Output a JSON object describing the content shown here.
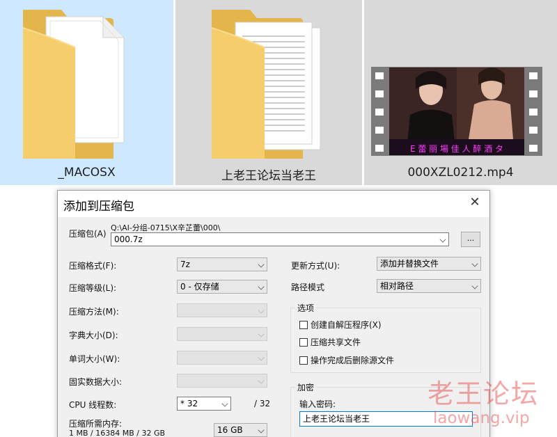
{
  "explorer": {
    "items": [
      {
        "name": "_MACOSX",
        "kind": "folder",
        "selected": true
      },
      {
        "name": "上老王论坛当老王",
        "kind": "folder",
        "selected": false
      },
      {
        "name": "000XZL0212.mp4",
        "kind": "video",
        "selected": false
      }
    ],
    "video_subtitle": "E 蕾 丽 場 佳 人 醉 酒 タ"
  },
  "dialog": {
    "title": "添加到压缩包",
    "close_glyph": "✕",
    "archive": {
      "label": "压缩包(A)",
      "path": "Q:\\AI-分组-0715\\X辛芷蕾\\000\\",
      "value": "000.7z",
      "browse_label": "..."
    },
    "left": {
      "format": {
        "label": "压缩格式(F):",
        "value": "7z"
      },
      "level": {
        "label": "压缩等级(L):",
        "value": "0 - 仅存储"
      },
      "method": {
        "label": "压缩方法(M):",
        "value": ""
      },
      "dict": {
        "label": "字典大小(D):",
        "value": ""
      },
      "word": {
        "label": "单词大小(W):",
        "value": ""
      },
      "solid": {
        "label": "固实数据大小:",
        "value": ""
      },
      "threads": {
        "label": "CPU 线程数:",
        "value": "* 32",
        "max": "/ 32"
      },
      "memory": {
        "label": "压缩所需内存:",
        "detail": "1 MB / 16384 MB / 32 GB",
        "value": "16 GB"
      }
    },
    "right": {
      "update": {
        "label": "更新方式(U):",
        "value": "添加并替换文件"
      },
      "pathmode": {
        "label": "路径模式",
        "value": "相对路径"
      },
      "options": {
        "legend": "选项",
        "items": [
          "创建自解压程序(X)",
          "压缩共享文件",
          "操作完成后删除源文件"
        ]
      },
      "encryption": {
        "legend": "加密",
        "password_label": "输入密码:",
        "password_value": "上老王论坛当老王"
      }
    }
  },
  "watermark": {
    "cn": "老王论坛",
    "en": "laowang.vip"
  }
}
